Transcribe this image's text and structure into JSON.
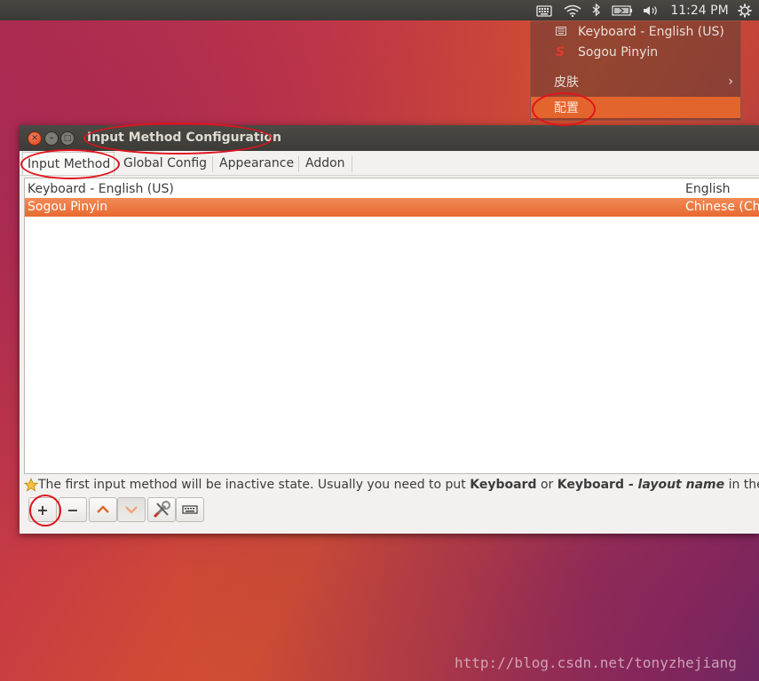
{
  "top_panel": {
    "clock": "11:24 PM",
    "icons": [
      "keyboard-icon",
      "wifi-icon",
      "bluetooth-icon",
      "battery-icon",
      "volume-icon",
      "power-icon"
    ]
  },
  "tray_menu": {
    "items": [
      {
        "label": "Keyboard - English (US)",
        "icon": "keyboard-icon"
      },
      {
        "label": "Sogou Pinyin",
        "icon": "sogou-icon"
      }
    ],
    "skin_label": "皮肤",
    "config_label": "配置"
  },
  "window": {
    "title": "Input Method Configuration",
    "tabs": [
      {
        "label": "Input Method",
        "active": true
      },
      {
        "label": "Global Config",
        "active": false
      },
      {
        "label": "Appearance",
        "active": false
      },
      {
        "label": "Addon",
        "active": false
      }
    ],
    "rows": [
      {
        "name": "Keyboard - English (US)",
        "language": "English",
        "selected": false
      },
      {
        "name": "Sogou Pinyin",
        "language": "Chinese (Chi",
        "selected": true
      }
    ],
    "info": {
      "part1": "The first input method will be inactive state. Usually you need to put ",
      "bold1": "Keyboard",
      "part2": " or ",
      "bold2": "Keyboard - ",
      "italic": "layout name",
      "part3": " in the first pl"
    },
    "toolbar": {
      "add": "+",
      "remove": "−"
    }
  },
  "watermark": "http://blog.csdn.net/tonyzhejiang",
  "colors": {
    "accent": "#e86a31",
    "annotation": "#e0141c"
  }
}
